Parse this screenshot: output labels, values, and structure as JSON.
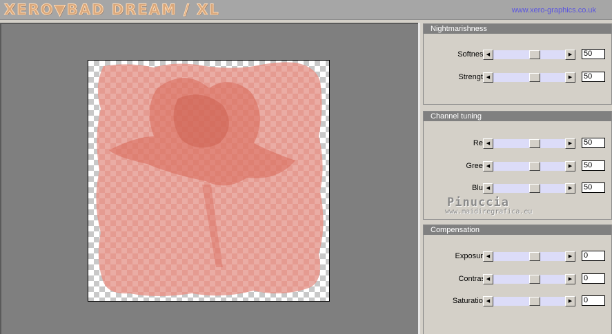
{
  "header": {
    "logo_text": "XERO▼BAD DREAM / XL",
    "site_link": "www.xero-graphics.co.uk"
  },
  "panels": [
    {
      "title": "Nightmarishness",
      "sliders": [
        {
          "label": "Softness",
          "value": "50"
        },
        {
          "label": "Strength",
          "value": "50"
        }
      ]
    },
    {
      "title": "Channel tuning",
      "sliders": [
        {
          "label": "Red",
          "value": "50"
        },
        {
          "label": "Green",
          "value": "50"
        },
        {
          "label": "Blue",
          "value": "50"
        }
      ]
    },
    {
      "title": "Compensation",
      "sliders": [
        {
          "label": "Exposure",
          "value": "0"
        },
        {
          "label": "Contrast",
          "value": "0"
        },
        {
          "label": "Saturation",
          "value": "0"
        }
      ]
    }
  ],
  "watermark": {
    "name": "Pinuccia",
    "url": "www.maidiregrafica.eu"
  },
  "colors": {
    "header_bg": "#a6a6a6",
    "link": "#5a55e0",
    "panel_title_bg": "#808080",
    "slider_track": "#dcdcf8",
    "preview_bg": "#7f7f7f",
    "image_tint": "#e07a6a"
  },
  "icons": {
    "slider_left": "triangle-left-icon",
    "slider_right": "triangle-right-icon"
  }
}
